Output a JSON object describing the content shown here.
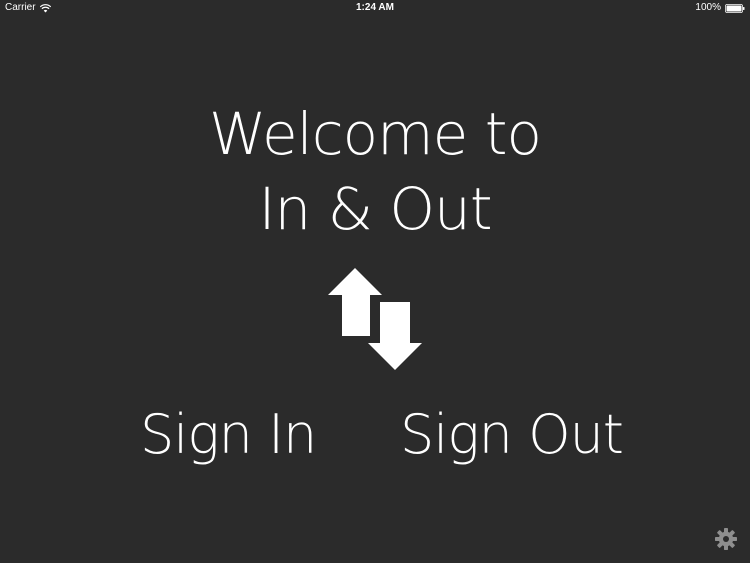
{
  "status_bar": {
    "carrier": "Carrier",
    "time": "1:24 AM",
    "battery": "100%"
  },
  "welcome": {
    "line1": "Welcome to",
    "line2": "In & Out"
  },
  "actions": {
    "sign_in": "Sign In",
    "sign_out": "Sign Out"
  },
  "icons": {
    "logo": "up-down-arrows-icon",
    "settings": "gear-icon",
    "wifi": "wifi-icon",
    "battery": "battery-icon"
  },
  "colors": {
    "background": "#2b2b2b",
    "foreground": "#ffffff",
    "gear": "#8e8e8e"
  }
}
